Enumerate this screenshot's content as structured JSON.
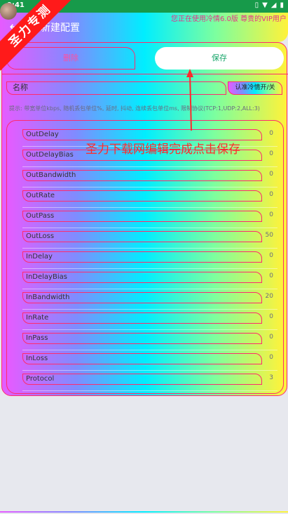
{
  "status_bar": {
    "time": "9:41"
  },
  "ribbon": {
    "text": "圣力专测"
  },
  "header": {
    "title": "新建配置",
    "marquee": "您正在使用冷情6.0版 尊贵的VIP用户"
  },
  "actions": {
    "delete_label": "删除",
    "save_label": "保存"
  },
  "name_field": {
    "placeholder": "名称"
  },
  "toggle": {
    "label": "认准冷情开/关"
  },
  "hint": "提示: 带宽单位kbps, 随机丢包单位%, 延时, 抖动, 连续丢包单位ms, 限制协议(TCP:1,UDP:2,ALL:3)",
  "annotation": "圣力下载网编辑完成点击保存",
  "params": [
    {
      "name": "OutDelay",
      "value": "0"
    },
    {
      "name": "OutDelayBias",
      "value": "0"
    },
    {
      "name": "OutBandwidth",
      "value": "0"
    },
    {
      "name": "OutRate",
      "value": "0"
    },
    {
      "name": "OutPass",
      "value": "0"
    },
    {
      "name": "OutLoss",
      "value": "50"
    },
    {
      "name": "InDelay",
      "value": "0"
    },
    {
      "name": "InDelayBias",
      "value": "0"
    },
    {
      "name": "InBandwidth",
      "value": "20"
    },
    {
      "name": "InRate",
      "value": "0"
    },
    {
      "name": "InPass",
      "value": "0"
    },
    {
      "name": "InLoss",
      "value": "0"
    },
    {
      "name": "Protocol",
      "value": "3"
    }
  ]
}
